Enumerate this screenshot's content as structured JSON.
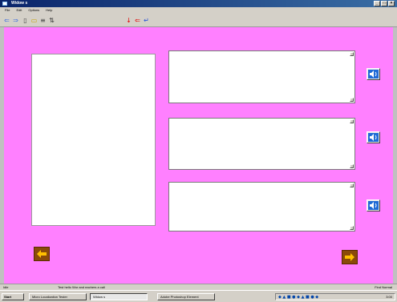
{
  "window": {
    "title": "Widow s"
  },
  "window_buttons": {
    "minimize": "_",
    "maximize": "□",
    "close": "×"
  },
  "menubar": {
    "items": [
      "File",
      "Edit",
      "Options",
      "Help"
    ]
  },
  "toolbar": {
    "icons": [
      {
        "name": "back-arrow-icon",
        "glyph": "⇐",
        "color": "#3c6ee0"
      },
      {
        "name": "forward-arrow-icon",
        "glyph": "⇒",
        "color": "#3c6ee0"
      },
      {
        "name": "page-icon",
        "glyph": "▯",
        "color": "#444444"
      },
      {
        "name": "folder-icon",
        "glyph": "▭",
        "color": "#c8a000"
      },
      {
        "name": "list-icon",
        "glyph": "≡",
        "color": "#444444"
      },
      {
        "name": "sort-icon",
        "glyph": "⇅",
        "color": "#3c3c3c"
      },
      {
        "name": "down-arrow-icon",
        "glyph": "↓",
        "color": "#e00000"
      },
      {
        "name": "left-arrow-icon",
        "glyph": "⇐",
        "color": "#e00000"
      },
      {
        "name": "enter-arrow-icon",
        "glyph": "↵",
        "color": "#1a4ad8"
      }
    ]
  },
  "colors": {
    "stage": "#ff80ff",
    "nav_button": "#8a4a0a",
    "arrow": "#ffc000"
  },
  "statusbar": {
    "left": "Idle",
    "middle": "Test hello Wor and eachers a cali",
    "right": "Find Normal"
  },
  "taskbar": {
    "start_label": "Start",
    "items": [
      {
        "label": "Micro Localization Tester"
      },
      {
        "label": "Widow s"
      },
      {
        "label": "Adobe Photoshop Element"
      }
    ],
    "clock": "3:00"
  }
}
